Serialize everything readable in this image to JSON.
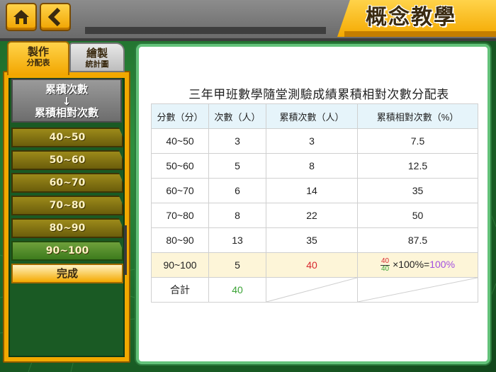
{
  "header": {
    "title": "概念教學",
    "home_icon": "home-icon",
    "back_icon": "chevron-left-icon"
  },
  "tabs": [
    {
      "line1": "製作",
      "line2": "分配表",
      "active": true
    },
    {
      "line1": "繪製",
      "line2": "統計圖",
      "active": false
    }
  ],
  "sidebar": {
    "header_line1": "累積次數",
    "header_arrow": "↓",
    "header_line2": "累積相對次數",
    "steps": [
      "40~50",
      "50~60",
      "60~70",
      "70~80",
      "80~90",
      "90~100"
    ],
    "done_label": "完成"
  },
  "table": {
    "title": "三年甲班數學隨堂測驗成績累積相對次數分配表",
    "headers": [
      "分數（分）",
      "次數（人）",
      "累積次數（人）",
      "累積相對次數（%）"
    ],
    "rows": [
      [
        "40~50",
        "3",
        "3",
        "7.5"
      ],
      [
        "50~60",
        "5",
        "8",
        "12.5"
      ],
      [
        "60~70",
        "6",
        "14",
        "35"
      ],
      [
        "70~80",
        "8",
        "22",
        "50"
      ],
      [
        "80~90",
        "13",
        "35",
        "87.5"
      ]
    ],
    "highlight_row": {
      "range": "90~100",
      "count": "5",
      "cumulative": "40",
      "frac_num": "40",
      "frac_den": "40",
      "formula": "×100%=",
      "result": "100%"
    },
    "total_row": {
      "label": "合計",
      "value": "40"
    }
  },
  "colors": {
    "accent_yellow": "#f4a900",
    "frame_green": "#63c27a",
    "highlight_red": "#d8282f",
    "total_green": "#3aa335",
    "result_purple": "#a34fe0"
  }
}
